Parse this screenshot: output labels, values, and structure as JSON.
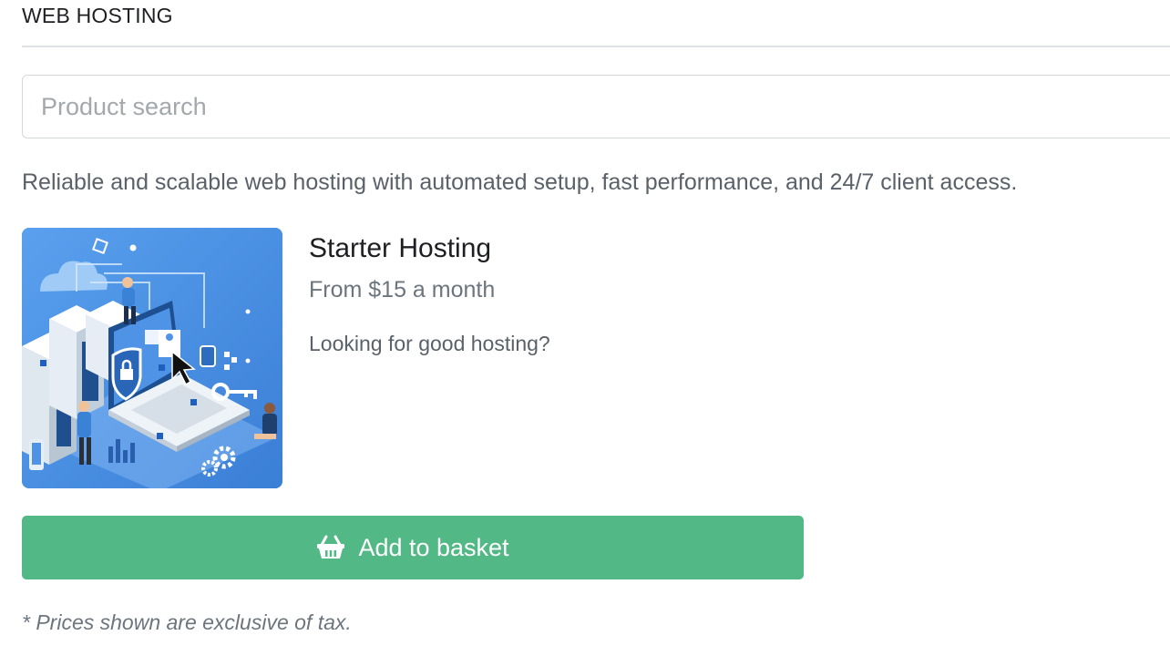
{
  "section": {
    "title": "WEB HOSTING"
  },
  "search": {
    "placeholder": "Product search"
  },
  "category": {
    "description": "Reliable and scalable web hosting with automated setup, fast performance, and 24/7 client access."
  },
  "product": {
    "name": "Starter Hosting",
    "price": "From $15 a month",
    "tagline": "Looking for good hosting?",
    "image_description": "isometric illustration of servers, laptop, security shield and people"
  },
  "actions": {
    "add_to_basket_label": "Add to basket",
    "add_to_basket_icon": "basket-icon"
  },
  "footer": {
    "tax_note": "* Prices shown are exclusive of tax."
  },
  "colors": {
    "button_green": "#52b885",
    "image_blue": "#4a90e2",
    "divider": "#dee2e6"
  }
}
